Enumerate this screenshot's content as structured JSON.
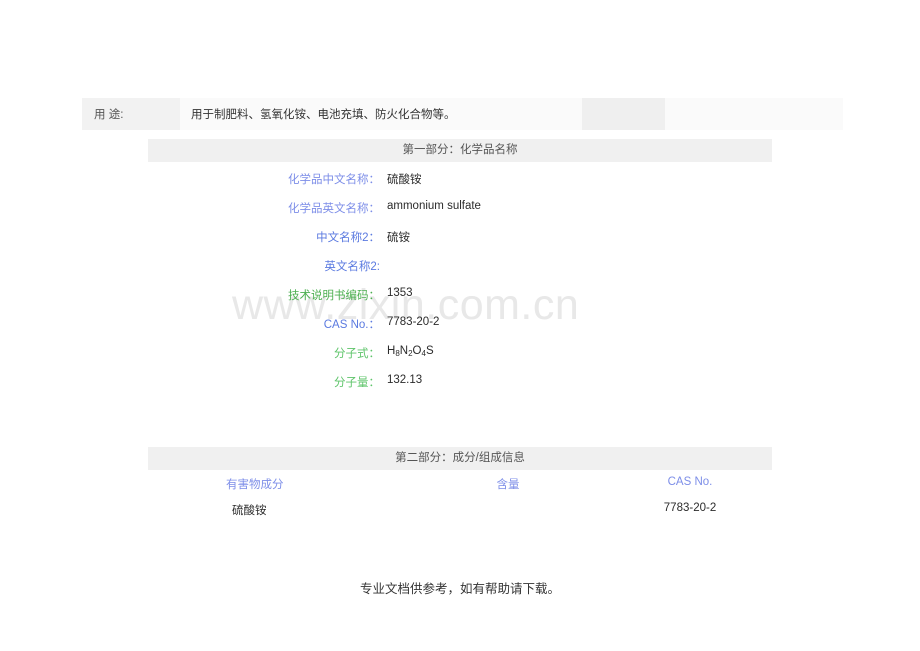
{
  "watermark": {
    "text": "www.zixin.com.cn"
  },
  "usage_row": {
    "label": "用 途:",
    "value": "用于制肥料、氢氧化铵、电池充填、防火化合物等。",
    "blank_cell": "",
    "tail_cell": ""
  },
  "sections": [
    {
      "title": "第一部分：化学品名称",
      "rows": [
        {
          "label": "化学品中文名称：",
          "value": "硫酸铵",
          "label_color": "#7d8ee8"
        },
        {
          "label": "化学品英文名称：",
          "value": "ammonium sulfate",
          "label_color": "#7d8ee8"
        },
        {
          "label": "中文名称2：",
          "value": "硫铵",
          "label_color": "#5b7ae0"
        },
        {
          "label": "英文名称2:",
          "value": "",
          "label_color": "#5b7ae0"
        },
        {
          "label": "技术说明书编码：",
          "value": "1353",
          "label_color": "#4caf50"
        },
        {
          "label": "CAS No.：",
          "value": "7783-20-2",
          "label_color": "#5b7ae0"
        },
        {
          "label": "分子式：",
          "value_formula": "H8N2O4S",
          "value": "",
          "label_color": "#5ec46a"
        },
        {
          "label": "分子量：",
          "value": "132.13",
          "label_color": "#5ec46a"
        }
      ]
    },
    {
      "title": "第二部分：成分/组成信息",
      "table": {
        "headers": [
          "有害物成分",
          "含量",
          "CAS No."
        ],
        "rows": [
          [
            "硫酸铵",
            "",
            "7783-20-2"
          ]
        ]
      }
    }
  ],
  "footer": {
    "text": "专业文档供参考，如有帮助请下载。"
  },
  "colors": {
    "band_light": "#fafafa",
    "band_label": "#f2f2f2",
    "band_dark": "#efefef",
    "section_bar": "#f0f0f0",
    "watermark": "#e8e8e8",
    "label_blue": "#7d8ee8",
    "label_blue_strong": "#5b7ae0",
    "label_green": "#4caf50",
    "text": "#2b2b2b"
  }
}
